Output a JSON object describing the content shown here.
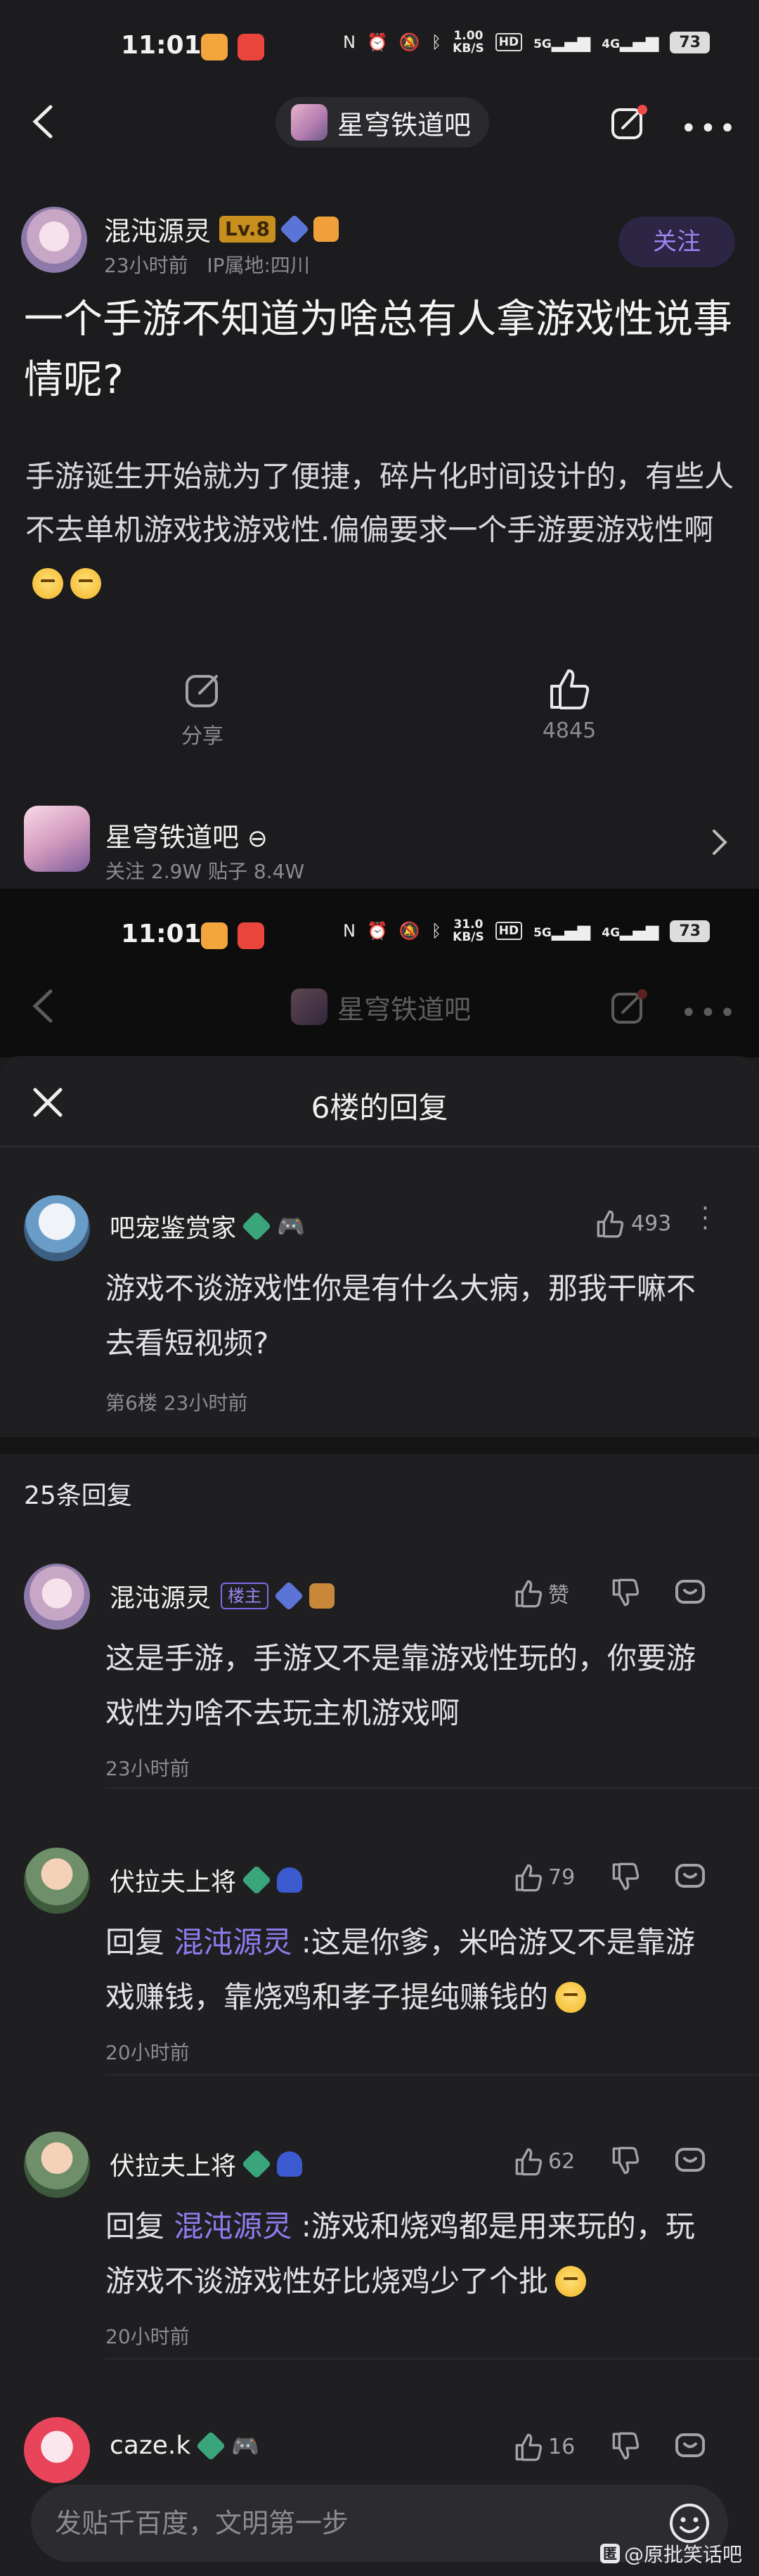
{
  "status_bar": {
    "time": "11:01",
    "speed_top": [
      "1.00",
      "KB/S"
    ],
    "speed_bottom": [
      "31.0",
      "KB/S"
    ],
    "network": "5G",
    "network2": "4G",
    "battery": "73",
    "hd": "HD"
  },
  "nav": {
    "forum_name": "星穹铁道吧"
  },
  "post": {
    "author": "混沌源灵",
    "level": "Lv.8",
    "time": "23小时前",
    "ip": "IP属地:四川",
    "follow_label": "关注",
    "title": "一个手游不知道为啥总有人拿游戏性说事情呢?",
    "body": "手游诞生开始就为了便捷，碎片化时间设计的，有些人不去单机游戏找游戏性.偏偏要求一个手游要游戏性啊",
    "share_label": "分享",
    "likes": "4845"
  },
  "forum_card": {
    "name": "星穹铁道吧",
    "stats": "关注 2.9W   贴子 8.4W"
  },
  "reply_sheet": {
    "title": "6楼的回复",
    "original": {
      "author": "吧宠鉴赏家",
      "likes": "493",
      "text": "游戏不谈游戏性你是有什么大病，那我干嘛不去看短视频?",
      "floor_time": "第6楼  23小时前"
    },
    "count_label": "25条回复",
    "replies": [
      {
        "author": "混沌源灵",
        "tag": "楼主",
        "like_label": "赞",
        "text": "这是手游，手游又不是靠游戏性玩的，你要游戏性为啥不去玩主机游戏啊",
        "time": "23小时前"
      },
      {
        "author": "伏拉夫上将",
        "likes": "79",
        "prefix": "回复",
        "mention": "混沌源灵",
        "text": ":这是你爹，米哈游又不是靠游戏赚钱，靠烧鸡和孝子提纯赚钱的",
        "time": "20小时前"
      },
      {
        "author": "伏拉夫上将",
        "likes": "62",
        "prefix": "回复",
        "mention": "混沌源灵",
        "text": ":游戏和烧鸡都是用来玩的，玩游戏不谈游戏性好比烧鸡少了个批",
        "time": "20小时前"
      },
      {
        "author": "caze.k",
        "likes": "16"
      }
    ]
  },
  "input": {
    "placeholder": "发贴千百度，文明第一步"
  },
  "watermark": {
    "logo": "匿",
    "text": "@原批笑话吧"
  },
  "colors": {
    "accent": "#8f7cf0",
    "level_badge": "#c7901e",
    "background": "#1c1c1e"
  }
}
